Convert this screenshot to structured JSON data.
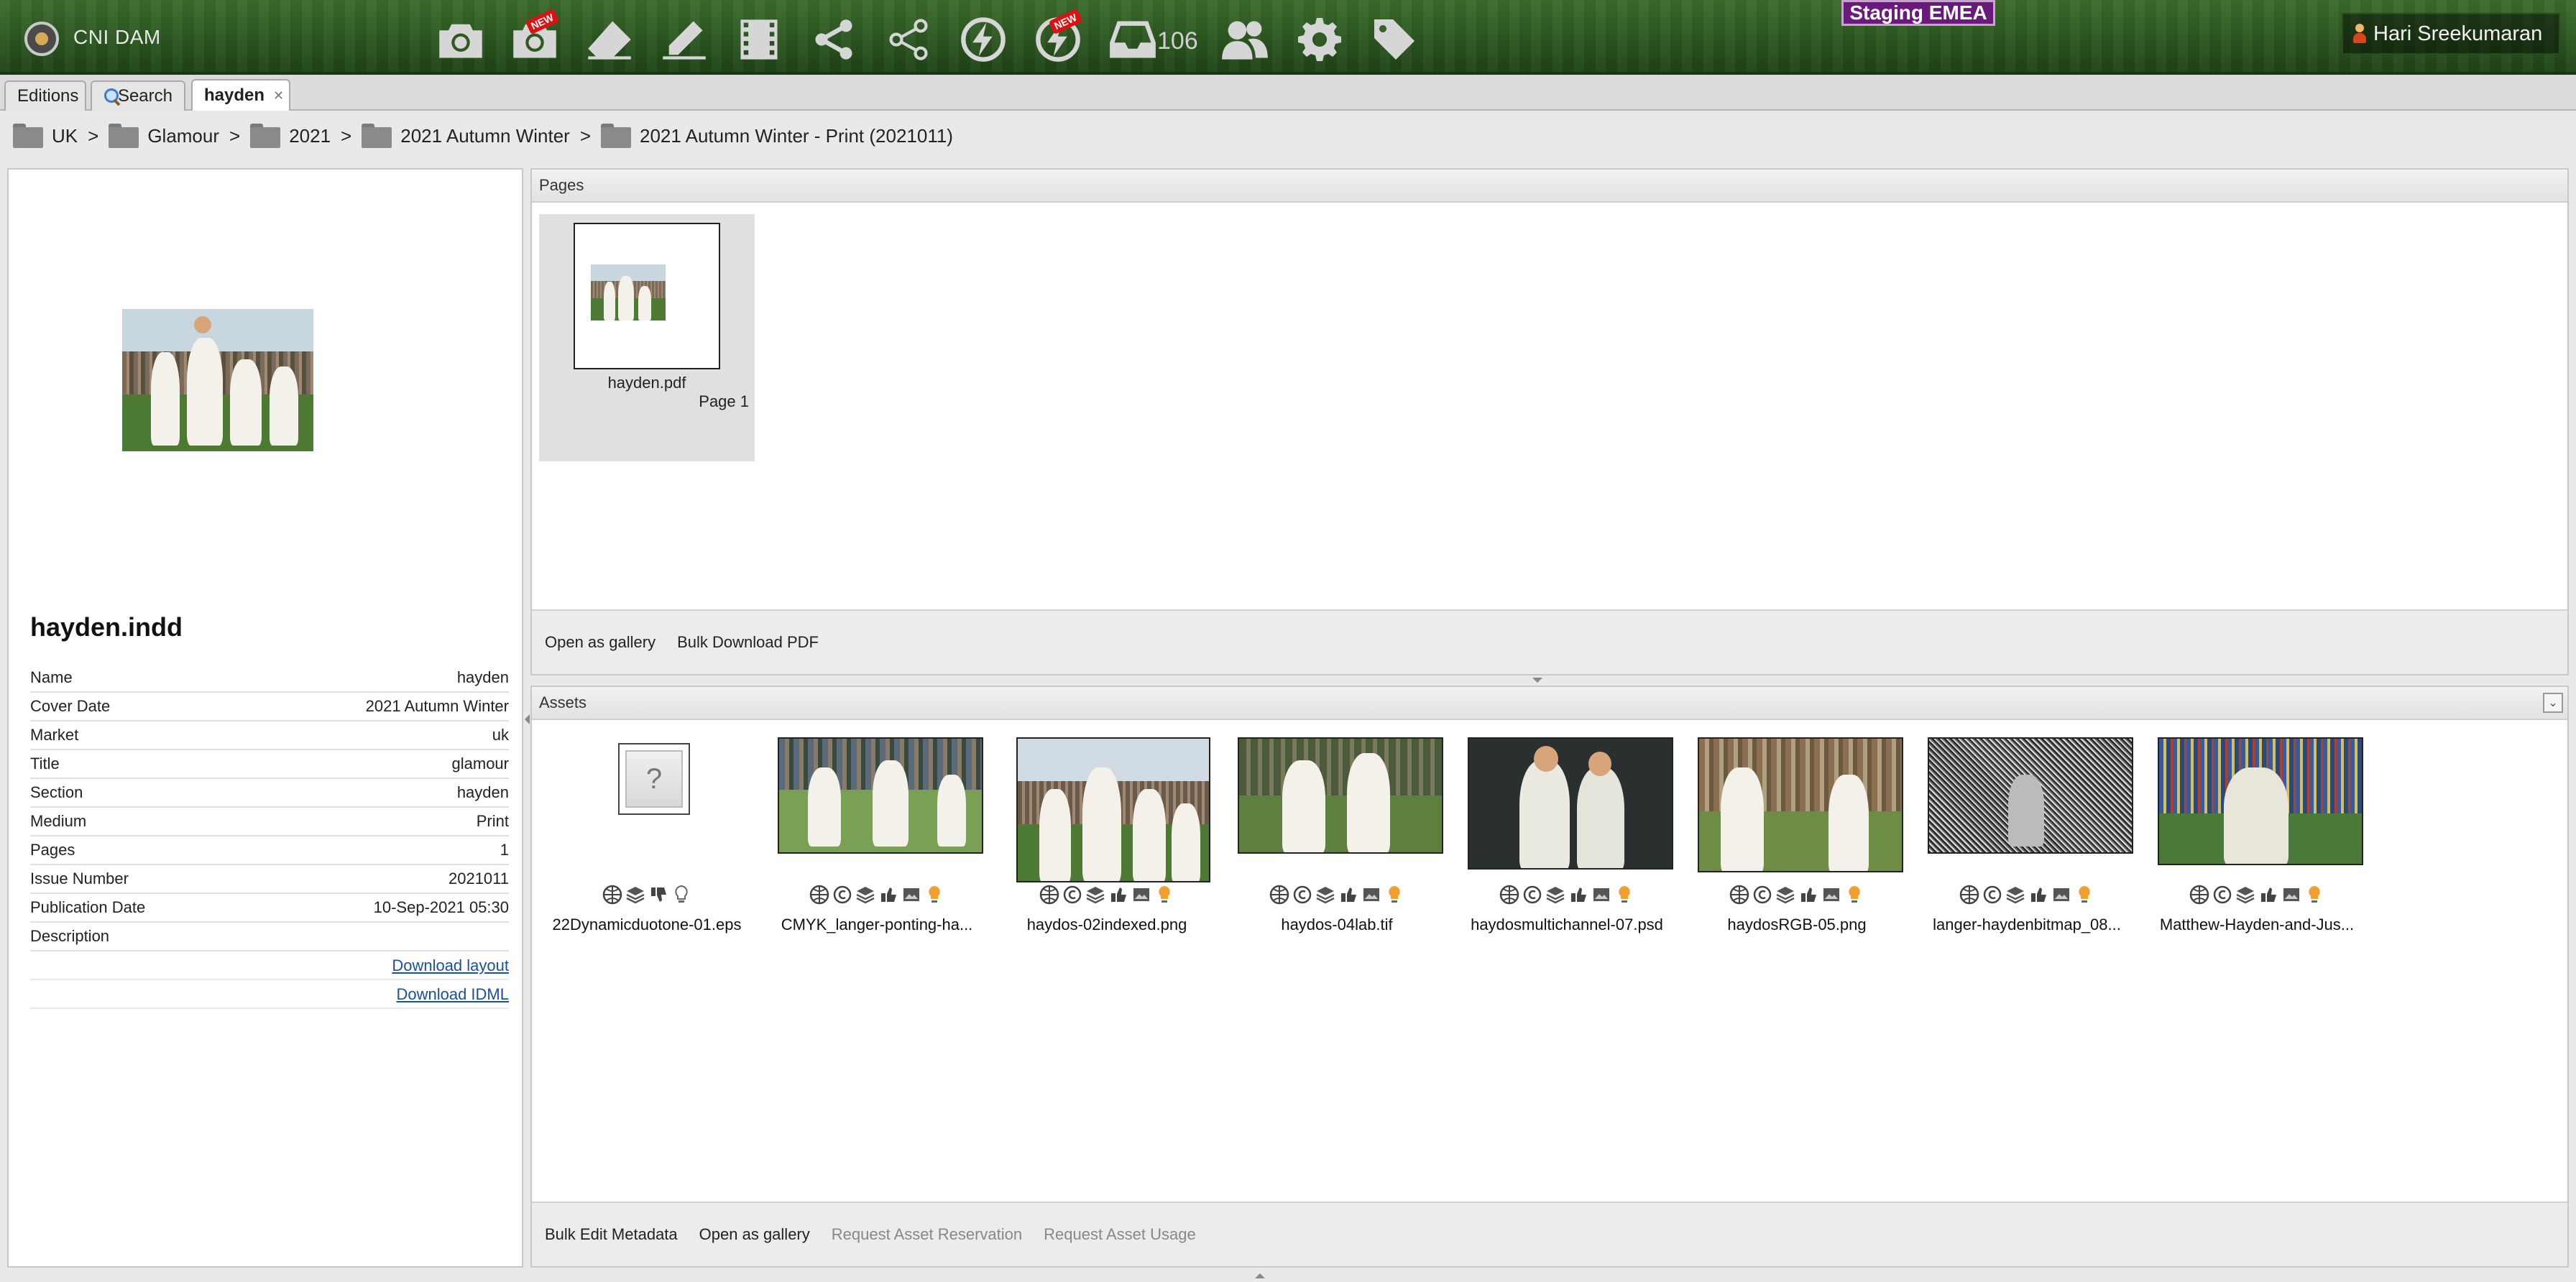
{
  "header": {
    "app_name": "CNI DAM",
    "inbox_count": "106",
    "environment": "Staging EMEA",
    "user_name": "Hari Sreekumaran",
    "toolbar_icons": [
      "camera-icon",
      "camera-new-icon",
      "eraser-icon",
      "pencil-icon",
      "film-icon",
      "share-icon",
      "share-outline-icon",
      "lightning-icon",
      "lightning-new-icon",
      "inbox-icon",
      "users-icon",
      "gear-icon",
      "tag-icon"
    ],
    "badge_label": "NEW"
  },
  "tabs": [
    {
      "label": "Editions"
    },
    {
      "label": "Search"
    },
    {
      "label": "hayden"
    }
  ],
  "breadcrumb": [
    {
      "label": "UK"
    },
    {
      "label": "Glamour"
    },
    {
      "label": "2021"
    },
    {
      "label": "2021 Autumn Winter"
    },
    {
      "label": "2021 Autumn Winter - Print (2021011)"
    }
  ],
  "breadcrumb_sep": ">",
  "details": {
    "title": "hayden.indd",
    "rows": [
      {
        "key": "Name",
        "value": "hayden"
      },
      {
        "key": "Cover Date",
        "value": "2021 Autumn Winter"
      },
      {
        "key": "Market",
        "value": "uk"
      },
      {
        "key": "Title",
        "value": "glamour"
      },
      {
        "key": "Section",
        "value": "hayden"
      },
      {
        "key": "Medium",
        "value": "Print"
      },
      {
        "key": "Pages",
        "value": "1"
      },
      {
        "key": "Issue Number",
        "value": "2021011"
      },
      {
        "key": "Publication Date",
        "value": "10-Sep-2021 05:30"
      },
      {
        "key": "Description",
        "value": ""
      }
    ],
    "download_layout": "Download layout",
    "download_idml": "Download IDML"
  },
  "pages_panel": {
    "title": "Pages",
    "page": {
      "file": "hayden.pdf",
      "label": "Page 1"
    },
    "footer": [
      "Open as gallery",
      "Bulk Download PDF"
    ]
  },
  "assets_panel": {
    "title": "Assets",
    "assets": [
      {
        "name": "22Dynamicduotone-01.eps",
        "type": "unknown"
      },
      {
        "name": "CMYK_langer-ponting-ha...",
        "type": "photo"
      },
      {
        "name": "haydos-02indexed.png",
        "type": "photo"
      },
      {
        "name": "haydos-04lab.tif",
        "type": "photo"
      },
      {
        "name": "haydosmultichannel-07.psd",
        "type": "photo"
      },
      {
        "name": "haydosRGB-05.png",
        "type": "photo"
      },
      {
        "name": "langer-haydenbitmap_08...",
        "type": "photo"
      },
      {
        "name": "Matthew-Hayden-and-Jus...",
        "type": "photo"
      }
    ],
    "footer": [
      {
        "label": "Bulk Edit Metadata",
        "enabled": true
      },
      {
        "label": "Open as gallery",
        "enabled": true
      },
      {
        "label": "Request Asset Reservation",
        "enabled": false
      },
      {
        "label": "Request Asset Usage",
        "enabled": false
      }
    ]
  },
  "colors": {
    "header_green": "#2e5a22",
    "env_purple": "#6a1a7a",
    "link_blue": "#1a4fa3",
    "bulb_orange": "#f0a030"
  }
}
